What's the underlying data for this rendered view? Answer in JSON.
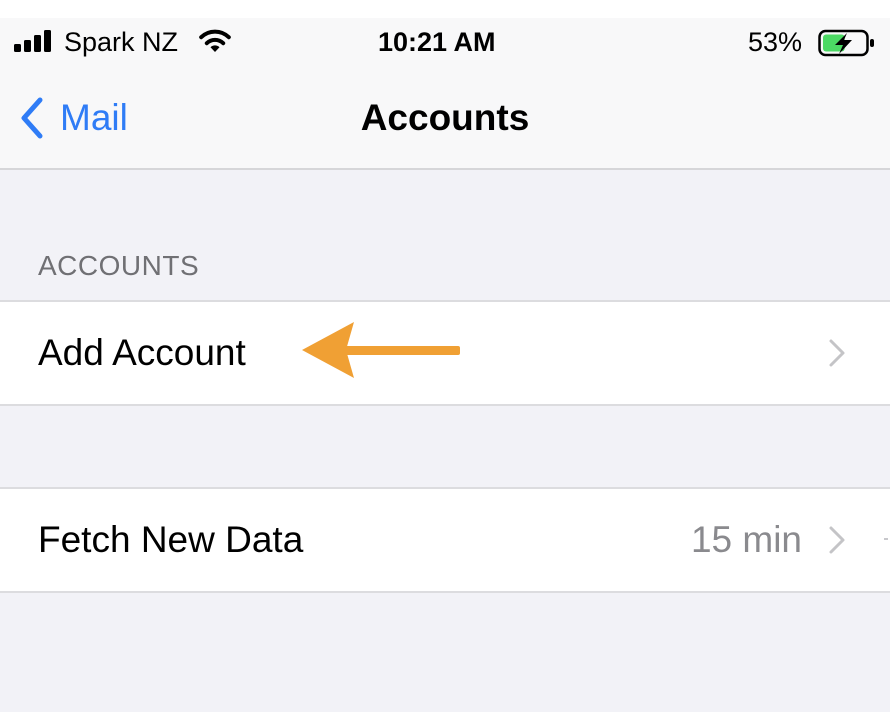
{
  "status_bar": {
    "carrier": "Spark NZ",
    "time": "10:21 AM",
    "battery_percent": "53%",
    "battery_level": 0.53,
    "battery_charging": true,
    "signal_bars": 4
  },
  "nav": {
    "back_label": "Mail",
    "title": "Accounts"
  },
  "sections": {
    "accounts_header": "ACCOUNTS"
  },
  "cells": {
    "add_account": {
      "label": "Add Account"
    },
    "fetch_new_data": {
      "label": "Fetch New Data",
      "value": "15 min"
    }
  },
  "icons": {
    "signal": "cellular-signal-icon",
    "wifi": "wifi-icon",
    "battery": "battery-charging-icon",
    "back": "chevron-left-icon",
    "disclosure": "chevron-right-icon",
    "annotation": "arrow-left-icon"
  },
  "colors": {
    "accent": "#2f7cf6",
    "annotation_arrow": "#f0a034",
    "battery_fill": "#4cd964",
    "grouped_background": "#f2f2f7"
  }
}
